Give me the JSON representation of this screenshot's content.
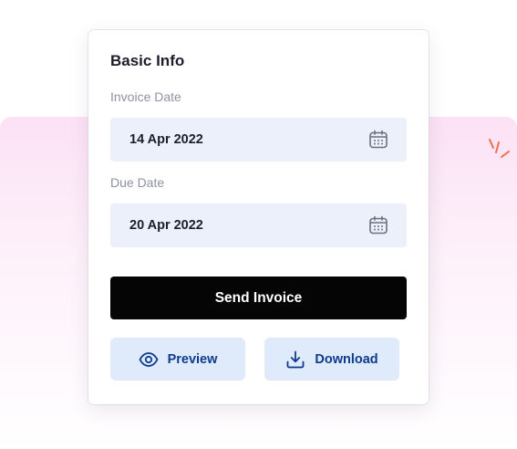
{
  "card": {
    "title": "Basic Info"
  },
  "invoice_date": {
    "label": "Invoice Date",
    "value": "14 Apr 2022",
    "icon": "calendar-icon"
  },
  "due_date": {
    "label": "Due Date",
    "value": "20 Apr 2022",
    "icon": "calendar-icon"
  },
  "actions": {
    "send_label": "Send Invoice",
    "preview_label": "Preview",
    "preview_icon": "eye-icon",
    "download_label": "Download",
    "download_icon": "download-icon"
  },
  "colors": {
    "primary_button": "#050506",
    "secondary_button_bg": "#dfeafb",
    "secondary_button_text": "#0e3b8c",
    "field_bg": "#ebf0fa",
    "backdrop_pink": "#fbe2f4",
    "sparkle_accent": "#f26b4a"
  }
}
